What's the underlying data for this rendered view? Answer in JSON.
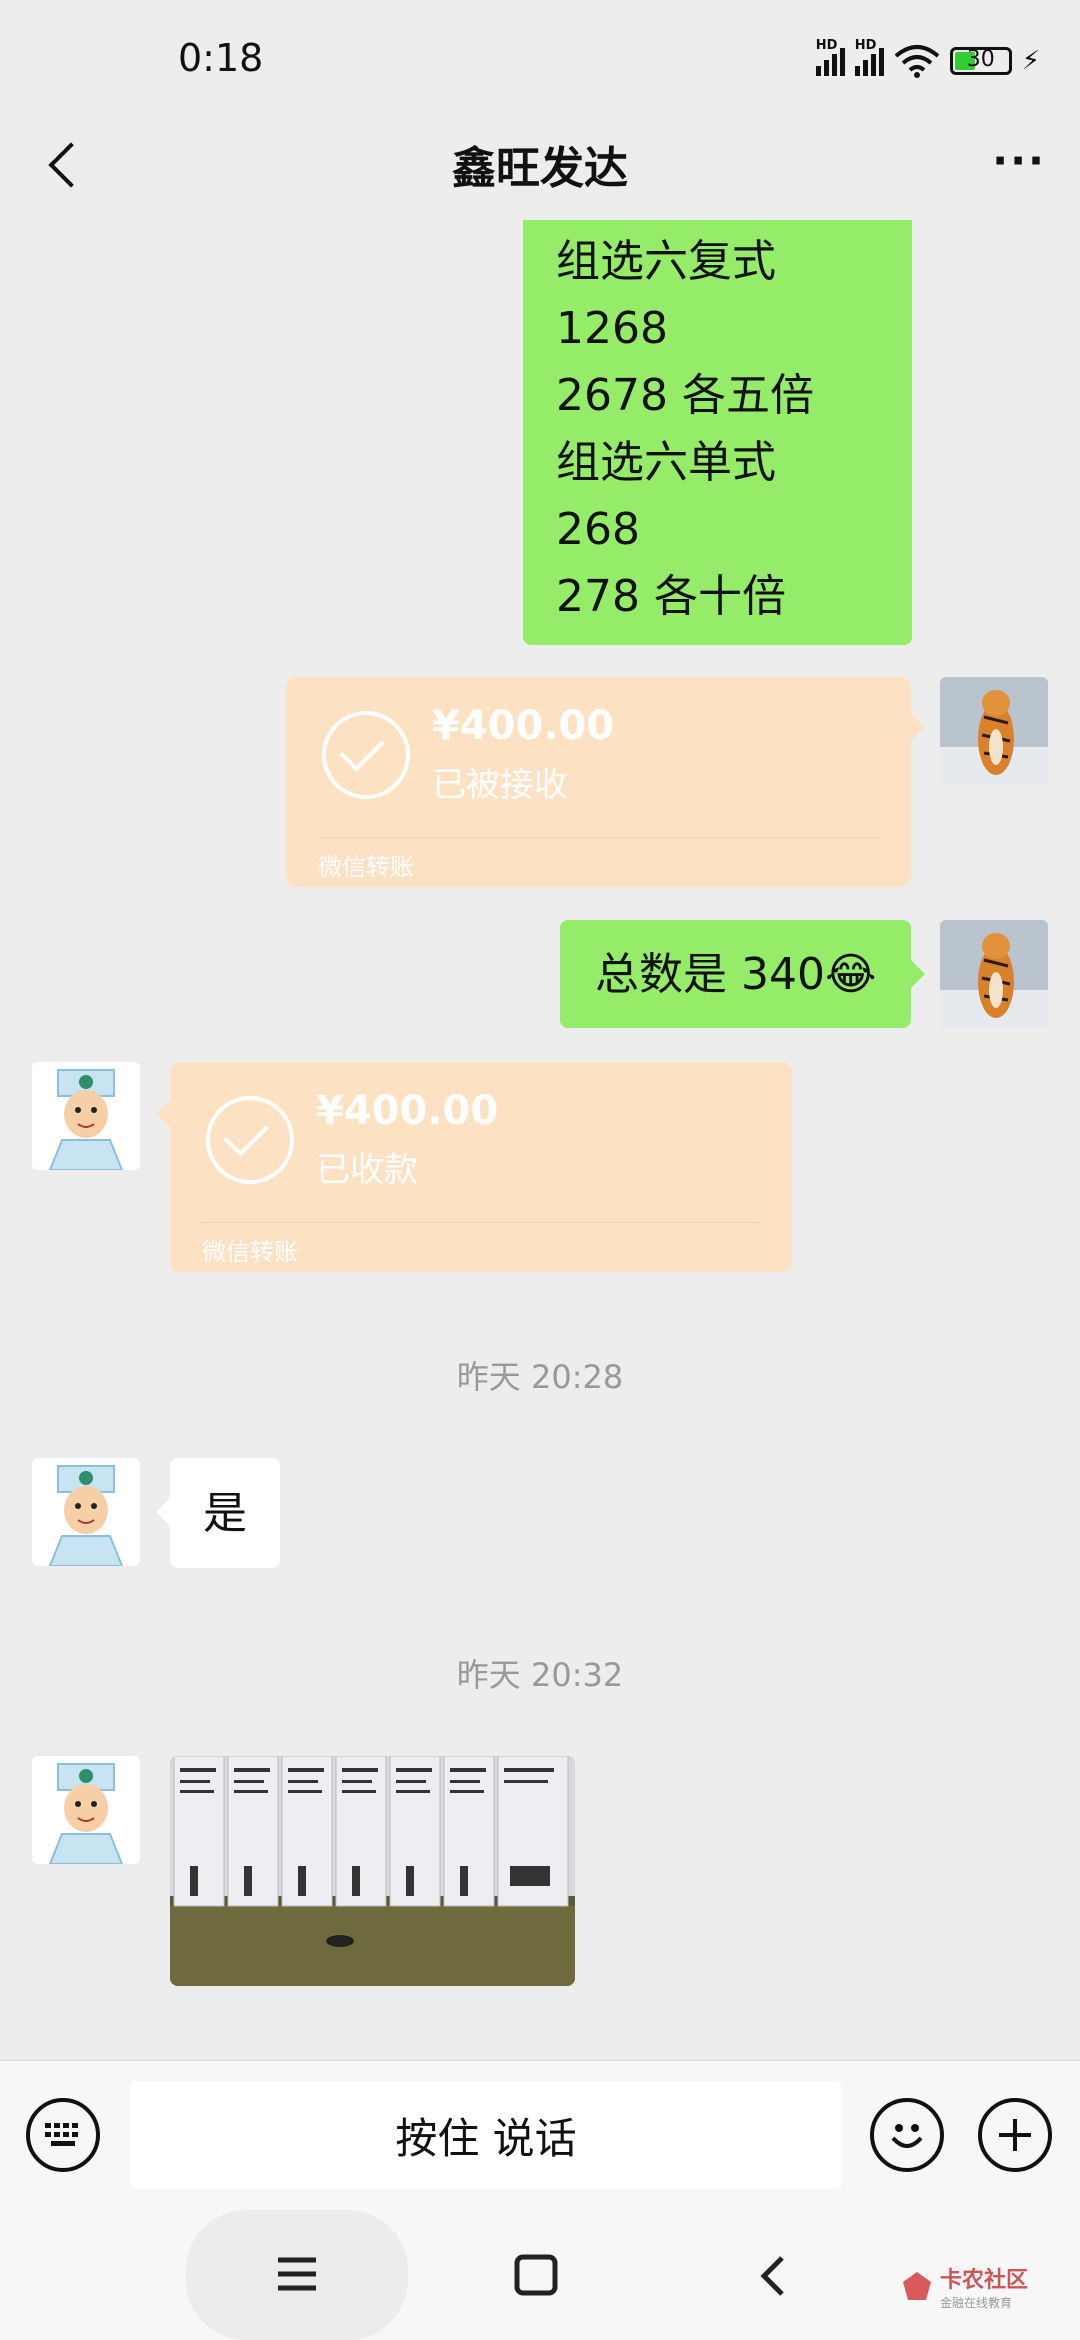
{
  "status": {
    "time": "0:18",
    "battery": "30",
    "hd1": "HD",
    "hd2": "HD"
  },
  "header": {
    "title": "鑫旺发达",
    "more": "···"
  },
  "messages": {
    "m1": {
      "lines": [
        "组选六复式",
        "1268",
        "2678 各五倍",
        "组选六单式",
        "268",
        "278 各十倍"
      ]
    },
    "m2": {
      "amount": "¥400.00",
      "status": "已被接收",
      "source": "微信转账"
    },
    "m3": {
      "text": "总数是 340",
      "emoji": "😂"
    },
    "m4": {
      "amount": "¥400.00",
      "status": "已收款",
      "source": "微信转账"
    },
    "t1": "昨天 20:28",
    "m5": {
      "text": "是"
    },
    "t2": "昨天 20:32"
  },
  "input": {
    "voice_label": "按住 说话"
  },
  "watermark": {
    "name": "卡农社区",
    "tagline": "金融在线教育"
  },
  "colors": {
    "sent": "#95ec69",
    "transfer": "#fde1c3",
    "background": "#ededed"
  }
}
